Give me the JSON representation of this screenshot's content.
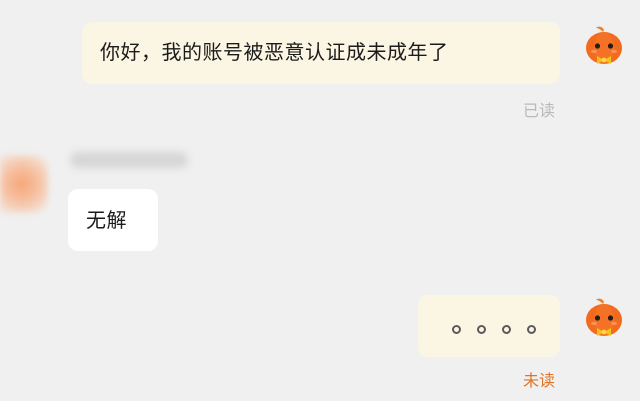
{
  "messages": [
    {
      "sender": "me",
      "text": "你好，我的账号被恶意认证成未成年了",
      "status": "已读"
    },
    {
      "sender": "other",
      "text": "无解"
    },
    {
      "sender": "me",
      "text": "。。。。",
      "status": "未读"
    }
  ],
  "colors": {
    "background": "#f0f0f0",
    "my_bubble": "#fbf6e3",
    "their_bubble": "#ffffff",
    "read_status": "#b9b9b9",
    "unread_status": "#e0752a",
    "avatar_orange": "#f06a1c"
  },
  "icons": {
    "my_avatar": "pumpkin-avatar-icon"
  }
}
